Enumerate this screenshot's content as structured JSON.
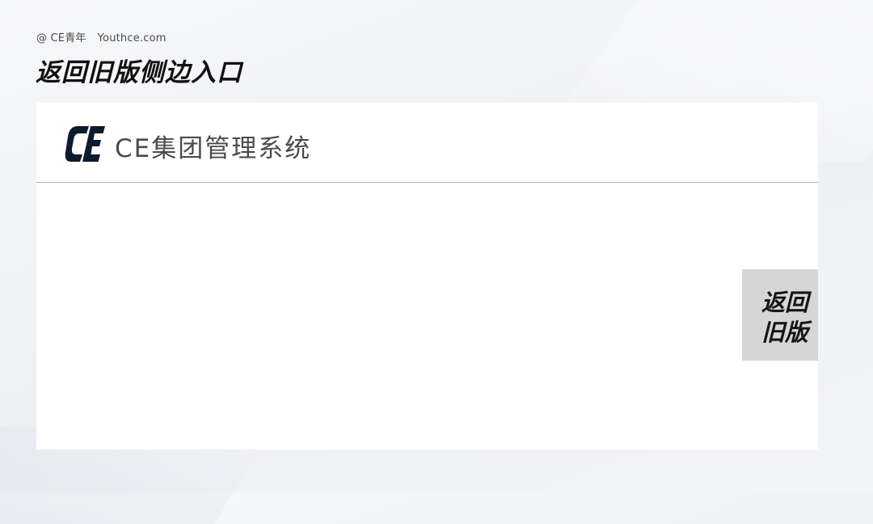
{
  "header": {
    "brand_prefix": "@ CE青年",
    "brand_site": "Youthce.com"
  },
  "slide": {
    "title": "返回旧版侧边入口"
  },
  "app": {
    "logo_icon": "ce-logo-icon",
    "logo_color": "#0d1b2e",
    "title": "CE集团管理系统"
  },
  "side_entry": {
    "line1": "返回",
    "line2": "旧版",
    "background": "#d6d6d6"
  }
}
